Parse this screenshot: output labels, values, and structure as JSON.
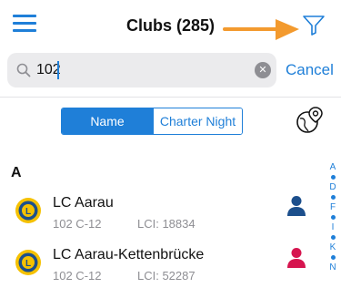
{
  "navbar": {
    "menu_icon": "hamburger-menu-icon",
    "title": "Clubs (285)",
    "filter_icon": "filter-funnel-icon",
    "annotation_arrow_color": "#f39a2e"
  },
  "search": {
    "value": "102",
    "placeholder": "Search",
    "clear_icon": "clear-circle-icon",
    "cancel_label": "Cancel"
  },
  "segments": [
    {
      "label": "Name",
      "selected": true
    },
    {
      "label": "Charter Night",
      "selected": false
    }
  ],
  "map_icon": "globe-location-icon",
  "section": {
    "header": "A"
  },
  "clubs": [
    {
      "name": "LC Aarau",
      "district": "102 C-12",
      "lci": "LCI: 18834",
      "person_color": "#1c4f8c"
    },
    {
      "name": "LC Aarau-Kettenbrücke",
      "district": "102 C-12",
      "lci": "LCI: 52287",
      "person_color": "#d6154f"
    }
  ],
  "index_letters": [
    "A",
    "D",
    "F",
    "I",
    "K",
    "N"
  ],
  "colors": {
    "accent": "#1f7fd8",
    "secondary_text": "#8e8e93",
    "lions_gold": "#f5c100",
    "lions_blue": "#1c4f8c"
  }
}
